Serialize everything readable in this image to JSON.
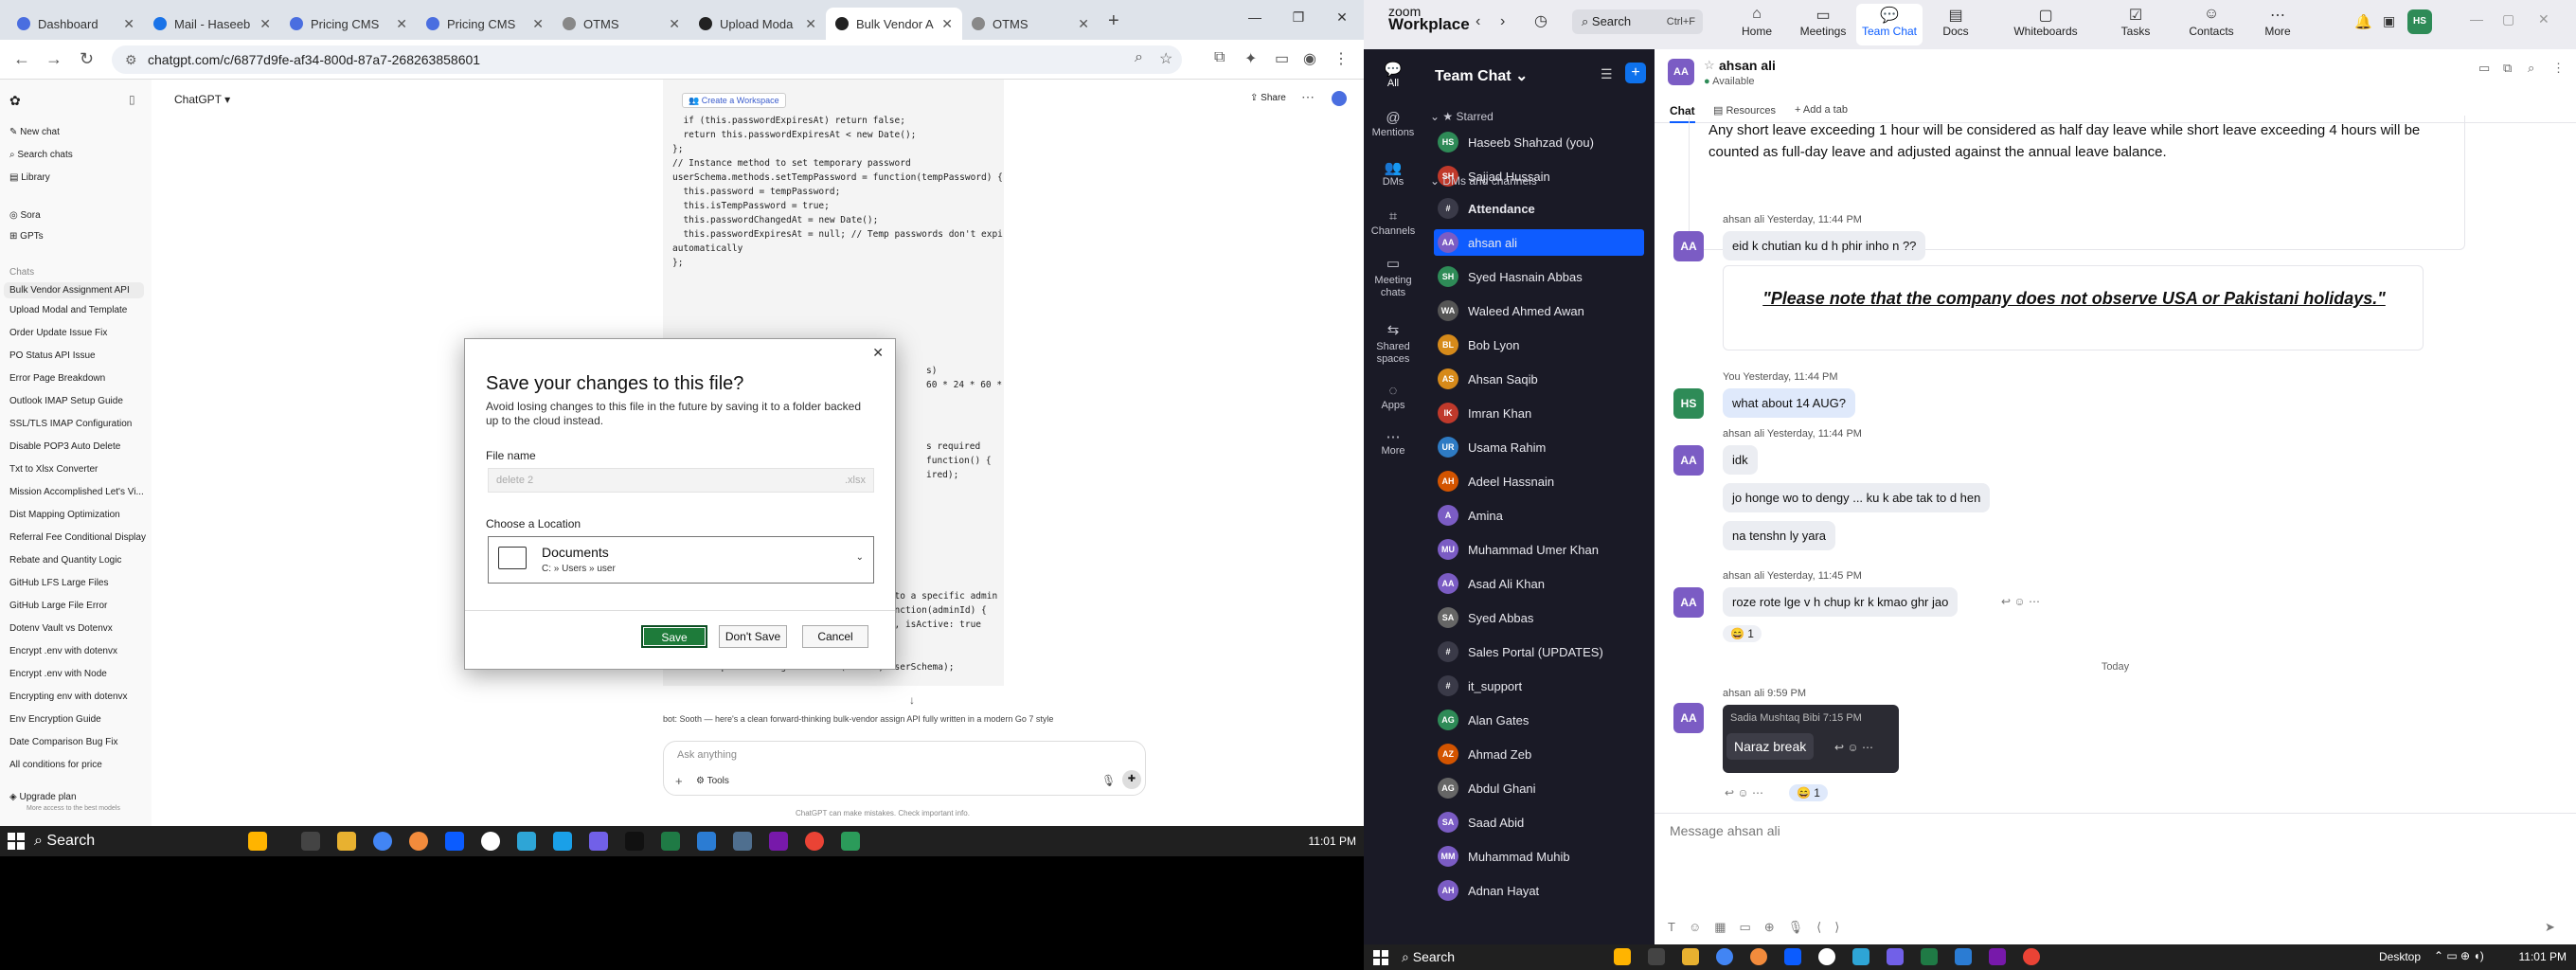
{
  "browser": {
    "tabs": [
      {
        "label": "Dashboard"
      },
      {
        "label": "Mail - Haseeb"
      },
      {
        "label": "Pricing CMS"
      },
      {
        "label": "Pricing CMS"
      },
      {
        "label": "OTMS"
      },
      {
        "label": "Upload Moda"
      },
      {
        "label": "Bulk Vendor A"
      },
      {
        "label": "OTMS"
      }
    ],
    "url": "chatgpt.com/c/6877d9fe-af34-800d-87a7-268263858601"
  },
  "chatgpt": {
    "model": "ChatGPT",
    "share": "Share",
    "sidebar": {
      "top": [
        "New chat",
        "Search chats",
        "Library"
      ],
      "apps": [
        "Sora",
        "GPTs"
      ],
      "chats_label": "Chats",
      "chats": [
        "Bulk Vendor Assignment API",
        "Upload Modal and Template",
        "Order Update Issue Fix",
        "PO Status API Issue",
        "Error Page Breakdown",
        "Outlook IMAP Setup Guide",
        "SSL/TLS IMAP Configuration",
        "Disable POP3 Auto Delete",
        "Txt to Xlsx Converter",
        "Mission Accomplished Let's Vi...",
        "Dist Mapping Optimization",
        "Referral Fee Conditional Display",
        "Rebate and Quantity Logic",
        "GitHub LFS Large Files",
        "GitHub Large File Error",
        "Dotenv Vault vs Dotenvx",
        "Encrypt .env with dotenvx",
        "Encrypt .env with Node",
        "Encrypting env with dotenvx",
        "Env Encryption Guide",
        "Date Comparison Bug Fix",
        "All conditions for price"
      ],
      "upgrade": "Upgrade plan",
      "upgrade_sub": "More access to the best models"
    },
    "code_lines": [
      "  if (this.passwordExpiresAt) return false;",
      "  return this.passwordExpiresAt < new Date();",
      "};",
      "",
      "// Instance method to set temporary password",
      "userSchema.methods.setTempPassword = function(tempPassword) {",
      "  this.password = tempPassword;",
      "  this.isTempPassword = true;",
      "  this.passwordChangedAt = new Date();",
      "  this.passwordExpiresAt = null; // Temp passwords don't expire",
      "automatically",
      "};"
    ],
    "code_lines_bottom": [
      "// Static method to find users reporting to a specific admin",
      "userSchema.statics.findByReportingTo = function(adminId) {",
      "  return this.find({ reportingTo: adminId, isActive: true",
      "}).populate('reportingTo', 'name email');",
      "};",
      "",
      "module.exports = mongoose.model('User', userSchema);"
    ],
    "code_right_fragments": [
      "s)",
      "60 * 24 * 60 * 60 *",
      "s required",
      "function() {",
      "ired);"
    ],
    "create_workspace": "Create a Workspace",
    "bot_text": "bot: Sooth — here's a clean forward-thinking bulk-vendor assign API fully written in a modern Go 7 style",
    "composer_placeholder": "Ask anything",
    "tools": "Tools",
    "disclaimer": "ChatGPT can make mistakes. Check important info."
  },
  "dialog": {
    "title": "Save your changes to this file?",
    "description": "Avoid losing changes to this file in the future by saving it to a folder backed up to the cloud instead.",
    "file_name_label": "File name",
    "file_name": "delete 2",
    "file_ext": ".xlsx",
    "location_label": "Choose a Location",
    "location_name": "Documents",
    "location_path": "C: » Users » user",
    "save": "Save",
    "dont_save": "Don't Save",
    "cancel": "Cancel"
  },
  "taskbar_left": {
    "search": "Search",
    "time": "11:01 PM"
  },
  "zoom": {
    "brand_top": "zoom",
    "brand_bottom": "Workplace",
    "search": "Search",
    "search_shortcut": "Ctrl+F",
    "nav": [
      "Home",
      "Meetings",
      "Team Chat",
      "Docs",
      "Whiteboards",
      "Tasks",
      "Contacts",
      "More"
    ],
    "user_initials": "HS",
    "rail": [
      "All",
      "Mentions",
      "DMs",
      "Channels",
      "Meeting chats",
      "Shared spaces",
      "Apps",
      "More"
    ],
    "panel_title": "Team Chat",
    "starred_label": "Starred",
    "starred": [
      {
        "name": "Haseeb Shahzad (you)",
        "init": "HS",
        "color": "#2e8b57"
      },
      {
        "name": "Sajjad Hussain",
        "init": "SH",
        "color": "#c0392b"
      }
    ],
    "dms_label": "DMs and channels",
    "channels": [
      {
        "name": "Attendance",
        "init": "#",
        "color": "#3a3a48"
      },
      {
        "name": "ahsan ali",
        "init": "AA",
        "color": "#7b5cc4"
      },
      {
        "name": "Syed Hasnain Abbas",
        "init": "SH",
        "color": "#2e8b57"
      },
      {
        "name": "Waleed Ahmed Awan",
        "init": "WA",
        "color": "#555"
      },
      {
        "name": "Bob Lyon",
        "init": "BL",
        "color": "#d68a1a"
      },
      {
        "name": "Ahsan Saqib",
        "init": "AS",
        "color": "#d68a1a"
      },
      {
        "name": "Imran Khan",
        "init": "IK",
        "color": "#c0392b"
      },
      {
        "name": "Usama Rahim",
        "init": "UR",
        "color": "#2e7bc4"
      },
      {
        "name": "Adeel Hassnain",
        "init": "AH",
        "color": "#d35400"
      },
      {
        "name": "Amina",
        "init": "A",
        "color": "#7b5cc4"
      },
      {
        "name": "Muhammad Umer Khan",
        "init": "MU",
        "color": "#7b5cc4"
      },
      {
        "name": "Asad Ali Khan",
        "init": "AA",
        "color": "#7b5cc4"
      },
      {
        "name": "Syed Abbas",
        "init": "SA",
        "color": "#666"
      },
      {
        "name": "Sales Portal (UPDATES)",
        "init": "#",
        "color": "#3a3a48"
      },
      {
        "name": "it_support",
        "init": "#",
        "color": "#3a3a48"
      },
      {
        "name": "Alan Gates",
        "init": "AG",
        "color": "#2e8b57"
      },
      {
        "name": "Ahmad Zeb",
        "init": "AZ",
        "color": "#d35400"
      },
      {
        "name": "Abdul Ghani",
        "init": "AG",
        "color": "#666"
      },
      {
        "name": "Saad Abid",
        "init": "SA",
        "color": "#7b5cc4"
      },
      {
        "name": "Muhammad Muhib",
        "init": "MM",
        "color": "#7b5cc4"
      },
      {
        "name": "Adnan Hayat",
        "init": "AH",
        "color": "#7b5cc4"
      }
    ],
    "chat_name": "ahsan ali",
    "chat_status": "Available",
    "chat_tabs": [
      "Chat",
      "Resources",
      "+ Add a tab"
    ],
    "messages": {
      "leave_policy": "Any short leave exceeding 1 hour will be considered as half day leave while short leave exceeding 4 hours will be counted as full-day leave and adjusted against the annual leave balance.",
      "m1_meta": "ahsan ali Yesterday, 11:44 PM",
      "m1": "eid k chutian ku d h phir inho n ??",
      "holiday_note": "\"Please note that the company does not observe USA or Pakistani holidays.\"",
      "m2_meta": "You Yesterday, 11:44 PM",
      "m2": "what about 14 AUG?",
      "m3_meta": "ahsan ali Yesterday, 11:44 PM",
      "m3a": "idk",
      "m3b": "jo honge wo to dengy ... ku k abe tak to d hen",
      "m3c": "na tenshn ly yara",
      "m4_meta": "ahsan ali Yesterday, 11:45 PM",
      "m4": "roze rote lge v h chup kr k kmao ghr jao",
      "m4_reaction": "😄 1",
      "day_divider": "Today",
      "m5_meta": "ahsan ali 9:59 PM",
      "m5_quote_meta": "Sadia Mushtaq Bibi 7:15 PM",
      "m5": "Naraz break",
      "m5_reaction": "😄 1"
    },
    "composer_placeholder": "Message ahsan ali"
  },
  "taskbar_right": {
    "search": "Search",
    "desktop": "Desktop",
    "time": "11:01 PM"
  }
}
